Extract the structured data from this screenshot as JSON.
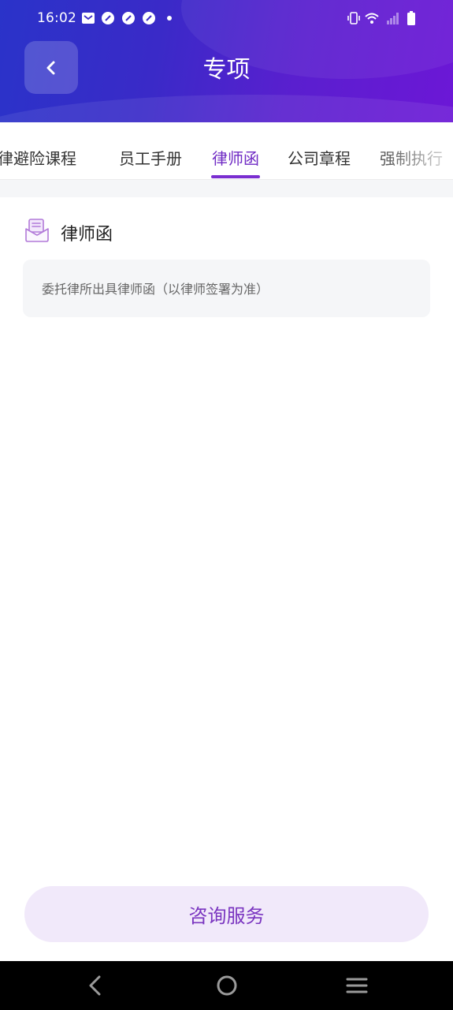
{
  "status_bar": {
    "time": "16:02",
    "left_icons": [
      "mail-icon",
      "app-badge-icon",
      "app-badge-icon",
      "app-badge-icon",
      "dot-icon"
    ],
    "right_icons": [
      "vibrate-icon",
      "wifi-icon",
      "signal-icon",
      "battery-icon"
    ]
  },
  "header": {
    "title": "专项",
    "back_icon": "chevron-left-icon"
  },
  "tabs": [
    {
      "label": "律避险课程",
      "active": false
    },
    {
      "label": "员工手册",
      "active": false
    },
    {
      "label": "律师函",
      "active": true
    },
    {
      "label": "公司章程",
      "active": false
    },
    {
      "label": "强制执行",
      "active": false
    }
  ],
  "section": {
    "icon": "letter-icon",
    "title": "律师函",
    "description": "委托律所出具律师函（以律师签署为准）"
  },
  "consult_button": {
    "label": "咨询服务"
  },
  "colors": {
    "header_gradient_start": "#2a33c9",
    "header_gradient_end": "#6c17d6",
    "accent": "#7a2ed0",
    "button_bg": "#f1e9fa",
    "button_text": "#7a35c0"
  },
  "nav_bar": {
    "icons": [
      "back-nav-icon",
      "home-nav-icon",
      "menu-nav-icon"
    ]
  }
}
